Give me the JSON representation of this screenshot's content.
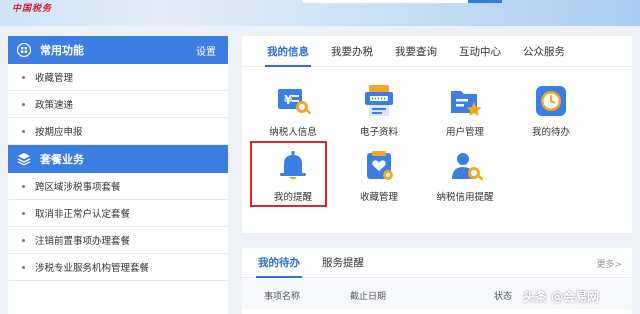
{
  "header": {
    "brand": "中国税务"
  },
  "sidebar": {
    "section1": {
      "title": "常用功能",
      "link": "设置",
      "items": [
        "收藏管理",
        "政策速递",
        "按期应申报"
      ]
    },
    "section2": {
      "title": "套餐业务",
      "items": [
        "跨区域涉税事项套餐",
        "取消非正常户认定套餐",
        "注销前置事项办理套餐",
        "涉税专业服务机构管理套餐"
      ]
    }
  },
  "main": {
    "tabs": [
      "我的信息",
      "我要办税",
      "我要查询",
      "互动中心",
      "公众服务"
    ],
    "active_tab": "我的信息",
    "grid": [
      {
        "label": "纳税人信息",
        "icon": "taxpayer-info-icon"
      },
      {
        "label": "电子资料",
        "icon": "e-documents-icon"
      },
      {
        "label": "用户管理",
        "icon": "user-management-icon"
      },
      {
        "label": "我的待办",
        "icon": "clock-icon"
      },
      {
        "label": "我的提醒",
        "icon": "bell-icon"
      },
      {
        "label": "收藏管理",
        "icon": "favorites-icon"
      },
      {
        "label": "纳税信用提醒",
        "icon": "credit-reminder-icon"
      }
    ]
  },
  "todo": {
    "tabs": [
      "我的待办",
      "服务提醒"
    ],
    "more": "更多>",
    "columns": [
      "事项名称",
      "截止日期",
      "状态"
    ]
  },
  "watermark": "头条 @会易网",
  "colors": {
    "accent": "#3d7ee3",
    "tab_active": "#2f6fd8",
    "highlight": "#e0242b",
    "icon_orange": "#f5a623"
  }
}
